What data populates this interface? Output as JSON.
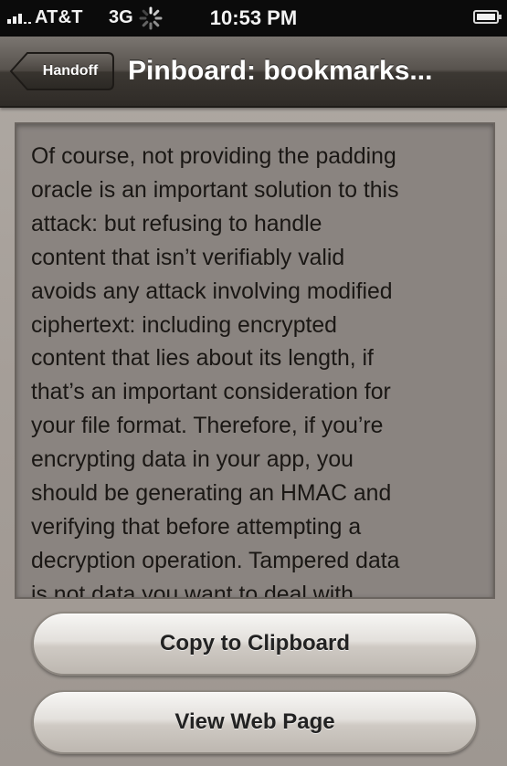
{
  "status_bar": {
    "carrier": "AT&T",
    "network": "3G",
    "time": "10:53 PM",
    "icons": [
      "signal-bars-icon",
      "activity-spinner-icon",
      "battery-icon"
    ]
  },
  "nav_bar": {
    "back_label": "Handoff",
    "title": "Pinboard: bookmarks..."
  },
  "content": {
    "lines": [
      "Of course, not providing the padding",
      "oracle is an important solution to this",
      "attack: but refusing to handle",
      "content that isn’t verifiably valid",
      "avoids any attack involving modified",
      "ciphertext: including encrypted",
      "content that lies about its length, if",
      "that’s an important consideration for",
      "your file format. Therefore, if you’re",
      "encrypting data in your app, you",
      "should be generating an HMAC and",
      "verifying that before attempting a",
      "decryption operation. Tampered data",
      "is not data you want to deal with."
    ]
  },
  "buttons": {
    "copy_label": "Copy to Clipboard",
    "view_label": "View Web Page"
  },
  "colors": {
    "status_bar_bg": "#0b0b0b",
    "nav_bar_bg": "#4a4540",
    "page_bg": "#a59f99",
    "text_box_bg": "#8a8480",
    "text_color": "#1a1714",
    "button_bg": "#e3e0dc"
  }
}
